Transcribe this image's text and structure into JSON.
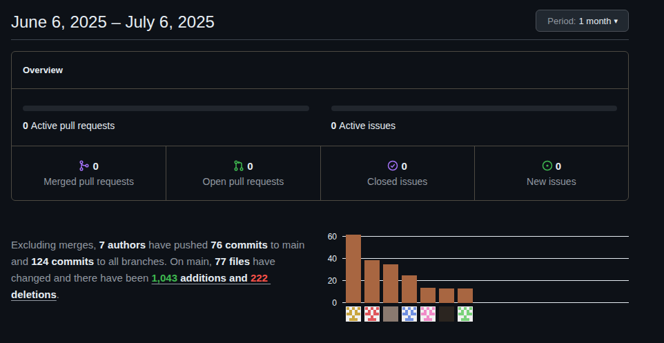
{
  "header": {
    "title": "June 6, 2025 – July 6, 2025",
    "period": {
      "label": "Period:",
      "value": "1 month",
      "caret": "▾"
    }
  },
  "overview": {
    "title": "Overview",
    "active": [
      {
        "count": "0",
        "label": "Active pull requests",
        "level": 0
      },
      {
        "count": "0",
        "label": "Active issues",
        "level": 0
      }
    ],
    "stats": [
      {
        "kind": "merged",
        "value": "0",
        "label": "Merged pull requests",
        "color": "#a371f7"
      },
      {
        "kind": "pr-open",
        "value": "0",
        "label": "Open pull requests",
        "color": "#3fb950"
      },
      {
        "kind": "issue-closed",
        "value": "0",
        "label": "Closed issues",
        "color": "#a371f7"
      },
      {
        "kind": "issue-open",
        "value": "0",
        "label": "New issues",
        "color": "#3fb950"
      }
    ]
  },
  "summary": [
    {
      "text": "Excluding merges, ",
      "kind": "plain"
    },
    {
      "text": "7 authors",
      "kind": "strong"
    },
    {
      "text": " have pushed ",
      "kind": "plain"
    },
    {
      "text": "76 commits",
      "kind": "strong"
    },
    {
      "text": " to main and ",
      "kind": "plain"
    },
    {
      "text": "124 commits",
      "kind": "strong"
    },
    {
      "text": " to all branches. On main, ",
      "kind": "plain"
    },
    {
      "text": "77 files",
      "kind": "strong"
    },
    {
      "text": " have changed and there have been ",
      "kind": "plain"
    },
    {
      "text": "1,043",
      "kind": "added"
    },
    {
      "text": " additions",
      "kind": "link"
    },
    {
      "text": " and ",
      "kind": "link"
    },
    {
      "text": "222",
      "kind": "deleted"
    },
    {
      "text": " deletions",
      "kind": "link"
    },
    {
      "text": ".",
      "kind": "plain"
    }
  ],
  "chart": {
    "ticks": [
      "60",
      "40",
      "20",
      "0"
    ],
    "max": 60,
    "values": [
      62,
      39,
      35,
      25,
      14,
      13,
      13
    ],
    "authors": [
      {
        "kind": "identicon",
        "color": "#c9a53e"
      },
      {
        "kind": "identicon",
        "color": "#e0565b"
      },
      {
        "kind": "photo",
        "color": "#8a7a70"
      },
      {
        "kind": "identicon",
        "color": "#6f8fe0"
      },
      {
        "kind": "identicon",
        "color": "#f08ac8"
      },
      {
        "kind": "photo",
        "color": "#2b2520"
      },
      {
        "kind": "identicon",
        "color": "#79d27a"
      }
    ]
  }
}
